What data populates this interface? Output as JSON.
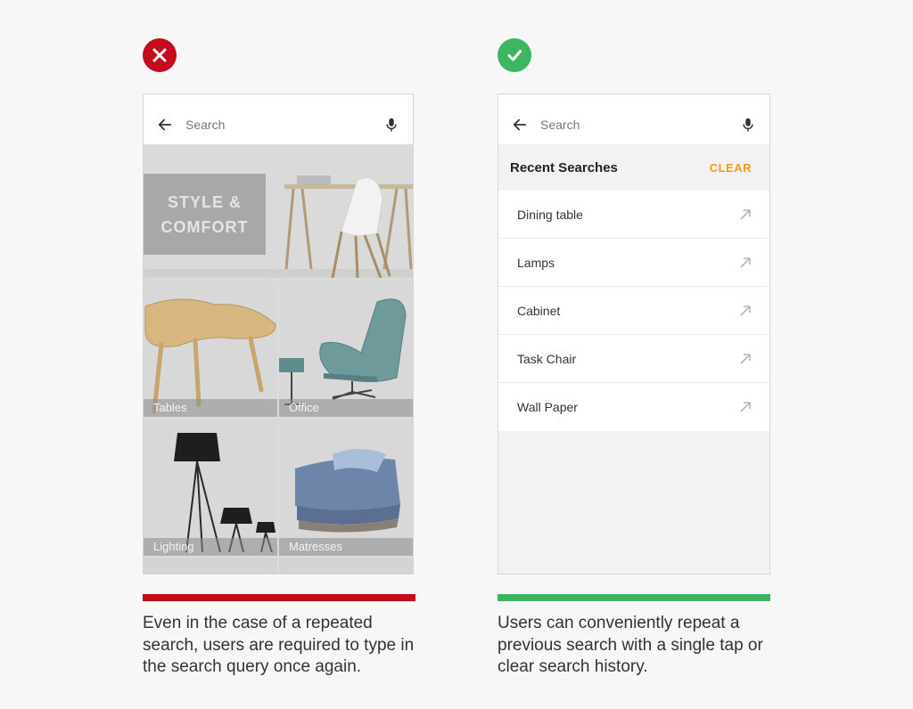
{
  "left_panel": {
    "status_color": "#c30c1c",
    "search_placeholder": "Search",
    "promo_line1": "STYLE &",
    "promo_line2": "COMFORT",
    "tiles": [
      "Tables",
      "Office",
      "Lighting",
      "Matresses"
    ],
    "caption": "Even in the case of a repeated search, users are required to type in the search query once again."
  },
  "right_panel": {
    "status_color": "#3cb661",
    "search_placeholder": "Search",
    "recent_title": "Recent Searches",
    "clear_label": "CLEAR",
    "recent_items": [
      "Dining table",
      "Lamps",
      "Cabinet",
      "Task Chair",
      "Wall Paper"
    ],
    "caption": "Users can conveniently repeat a previous search with a single tap or clear search history."
  }
}
